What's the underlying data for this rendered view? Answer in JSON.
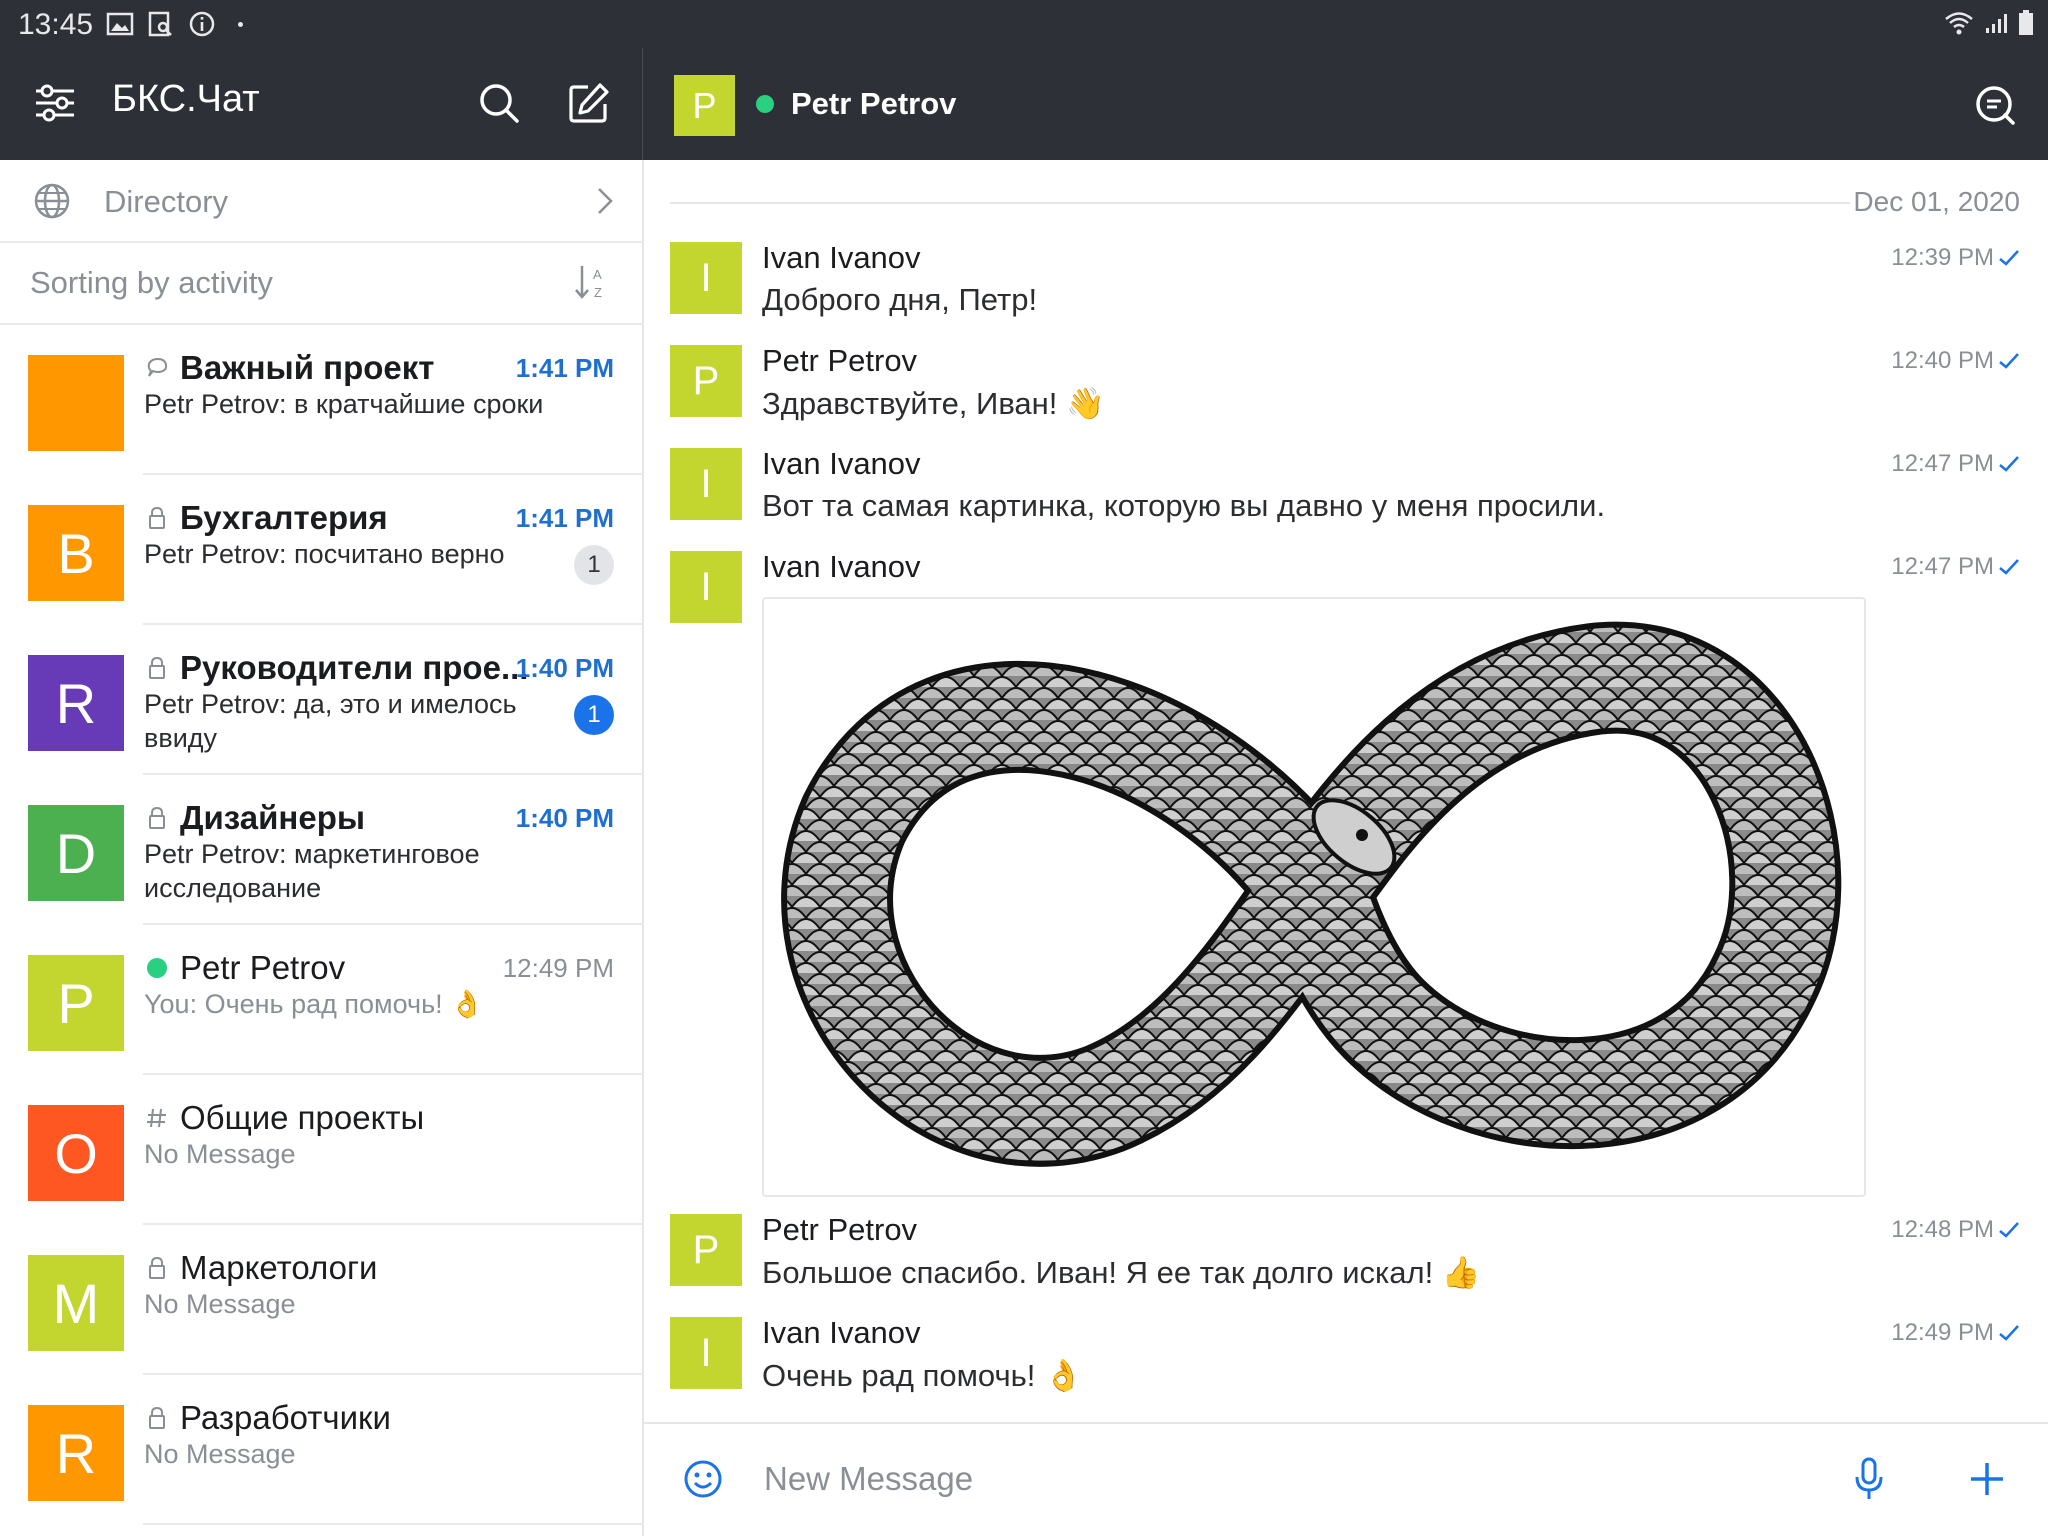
{
  "status_bar": {
    "time": "13:45"
  },
  "left_header": {
    "app_title": "БКС.Чат"
  },
  "right_header": {
    "avatar_letter": "P",
    "contact_name": "Petr Petrov"
  },
  "sidebar": {
    "directory_label": "Directory",
    "sorting_label": "Sorting by activity",
    "conversations": [
      {
        "title": "Важный проект",
        "time": "1:41 PM",
        "preview": "Petr Petrov: в кратчайшие сроки",
        "avatar": "",
        "avatar_color": "#ff9800",
        "title_icon": "chat-icon",
        "time_highlight": true,
        "badge": ""
      },
      {
        "title": "Бухгалтерия",
        "time": "1:41 PM",
        "preview": "Petr Petrov: посчитано верно",
        "avatar": "B",
        "avatar_color": "#ff9800",
        "title_icon": "lock-icon",
        "time_highlight": true,
        "badge": "1",
        "badge_style": "grey"
      },
      {
        "title": "Руководители прое...",
        "time": "1:40 PM",
        "preview": "Petr Petrov: да, это и имелось ввиду",
        "avatar": "R",
        "avatar_color": "#673ab7",
        "title_icon": "lock-icon",
        "time_highlight": true,
        "badge": "1",
        "badge_style": "blue"
      },
      {
        "title": "Дизайнеры",
        "time": "1:40 PM",
        "preview": "Petr Petrov: маркетинговое исследование",
        "avatar": "D",
        "avatar_color": "#4caf50",
        "title_icon": "lock-icon",
        "time_highlight": true,
        "badge": ""
      },
      {
        "title": "Petr Petrov",
        "time": "12:49 PM",
        "preview": "You: Очень рад помочь! 👌",
        "avatar": "P",
        "avatar_color": "#c3d62f",
        "title_icon": "online-dot",
        "time_highlight": false,
        "badge": ""
      },
      {
        "title": "Общие проекты",
        "time": "",
        "preview": "No Message",
        "avatar": "O",
        "avatar_color": "#ff5722",
        "title_icon": "hash-icon",
        "time_highlight": false,
        "badge": ""
      },
      {
        "title": "Маркетологи",
        "time": "",
        "preview": "No Message",
        "avatar": "M",
        "avatar_color": "#c3d62f",
        "title_icon": "lock-icon",
        "time_highlight": false,
        "badge": ""
      },
      {
        "title": "Разработчики",
        "time": "",
        "preview": "No Message",
        "avatar": "R",
        "avatar_color": "#ff9800",
        "title_icon": "lock-icon",
        "time_highlight": false,
        "badge": ""
      }
    ]
  },
  "chat": {
    "date_separator": "Dec 01, 2020",
    "messages": [
      {
        "avatar": "I",
        "author": "Ivan Ivanov",
        "time": "12:39 PM",
        "text": "Доброго дня, Петр!"
      },
      {
        "avatar": "P",
        "author": "Petr Petrov",
        "time": "12:40 PM",
        "text": "Здравствуйте, Иван! 👋"
      },
      {
        "avatar": "I",
        "author": "Ivan Ivanov",
        "time": "12:47 PM",
        "text": "Вот та самая картинка, которую вы давно у меня просили."
      },
      {
        "avatar": "I",
        "author": "Ivan Ivanov",
        "time": "12:47 PM",
        "text": "",
        "attachment": "ouroboros-infinity-snake-image"
      },
      {
        "avatar": "P",
        "author": "Petr Petrov",
        "time": "12:48 PM",
        "text": "Большое спасибо. Иван! Я ее так долго искал! 👍"
      },
      {
        "avatar": "I",
        "author": "Ivan Ivanov",
        "time": "12:49 PM",
        "text": "Очень рад помочь! 👌"
      }
    ]
  },
  "composer": {
    "placeholder": "New Message"
  },
  "colors": {
    "header_bg": "#2e3038",
    "accent_blue": "#1a73e8",
    "online_green": "#29d07f",
    "avatar_lime": "#c3d62f"
  }
}
